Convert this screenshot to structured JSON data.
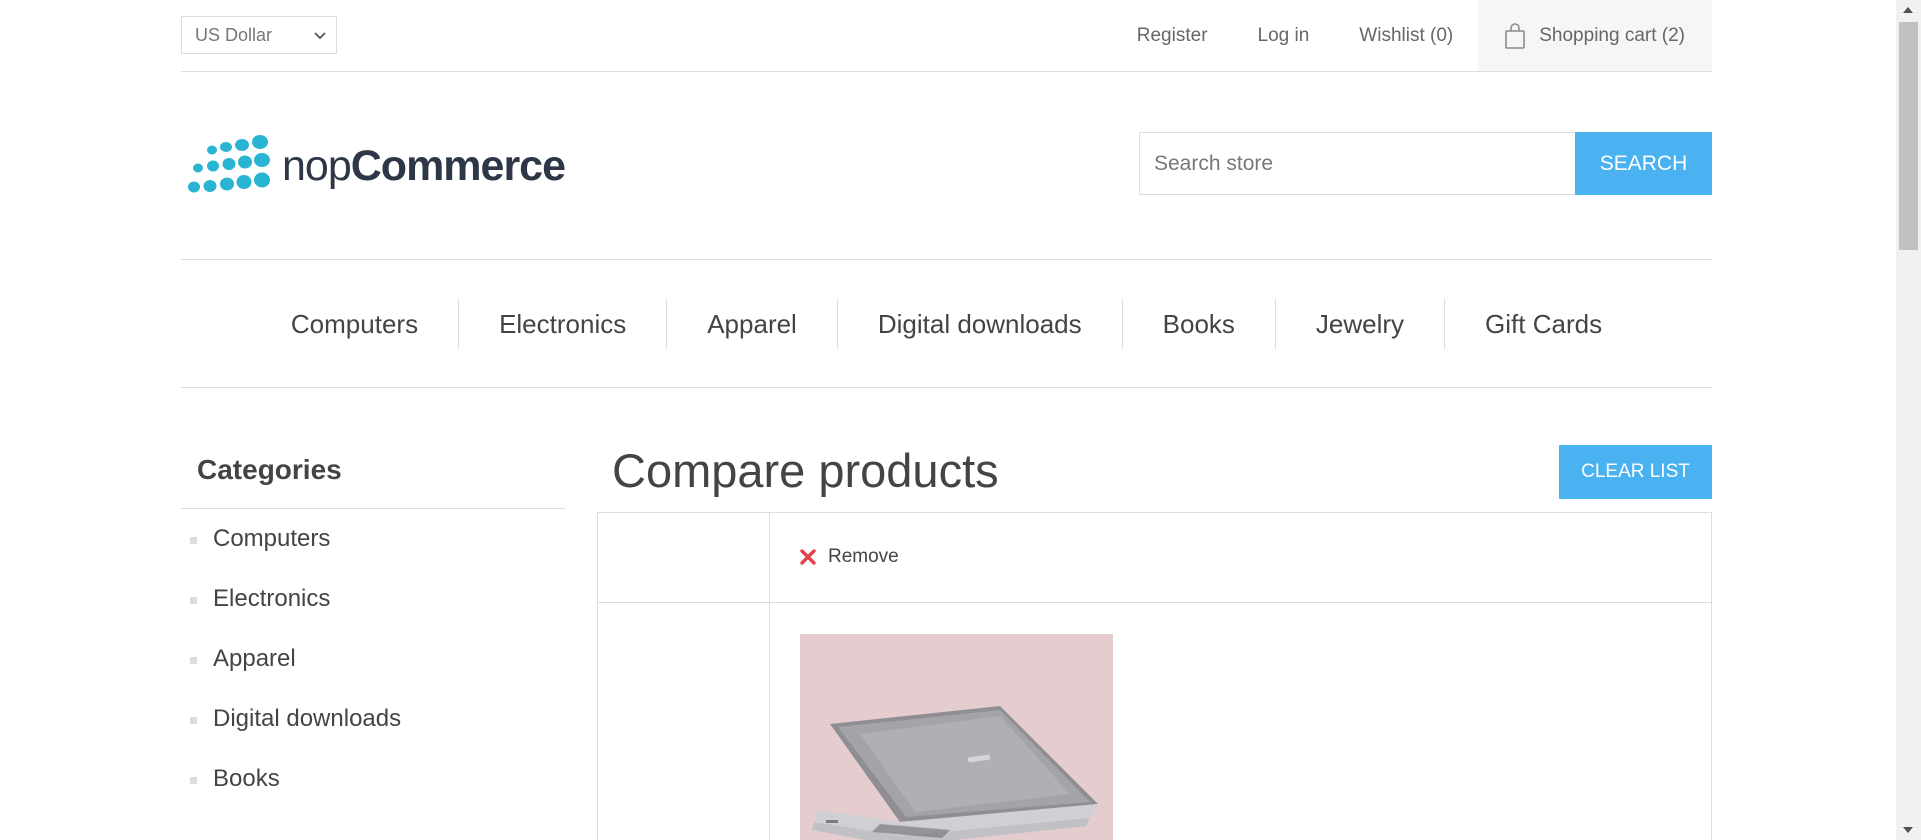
{
  "header": {
    "currency": {
      "selected": "US Dollar"
    },
    "links": {
      "register": "Register",
      "login": "Log in",
      "wishlist": "Wishlist (0)",
      "cart": "Shopping cart (2)"
    }
  },
  "logo": {
    "text_light": "nop",
    "text_bold": "Commerce"
  },
  "search": {
    "placeholder": "Search store",
    "button_label": "SEARCH"
  },
  "menu": {
    "items": [
      "Computers",
      "Electronics",
      "Apparel",
      "Digital downloads",
      "Books",
      "Jewelry",
      "Gift Cards"
    ]
  },
  "sidebar": {
    "title": "Categories",
    "items": [
      "Computers",
      "Electronics",
      "Apparel",
      "Digital downloads",
      "Books"
    ]
  },
  "main": {
    "title": "Compare products",
    "clear_label": "CLEAR LIST",
    "remove_label": "Remove"
  },
  "colors": {
    "accent": "#4ab2f1",
    "remove_icon": "#e4434b",
    "logo_dots": "#2ab4d4",
    "logo_text": "#2e3747",
    "product_bg": "#e4cccf"
  },
  "icons": {
    "currency_chevron": "chevron-down-icon",
    "cart": "shopping-bag-icon",
    "remove": "close-icon"
  }
}
